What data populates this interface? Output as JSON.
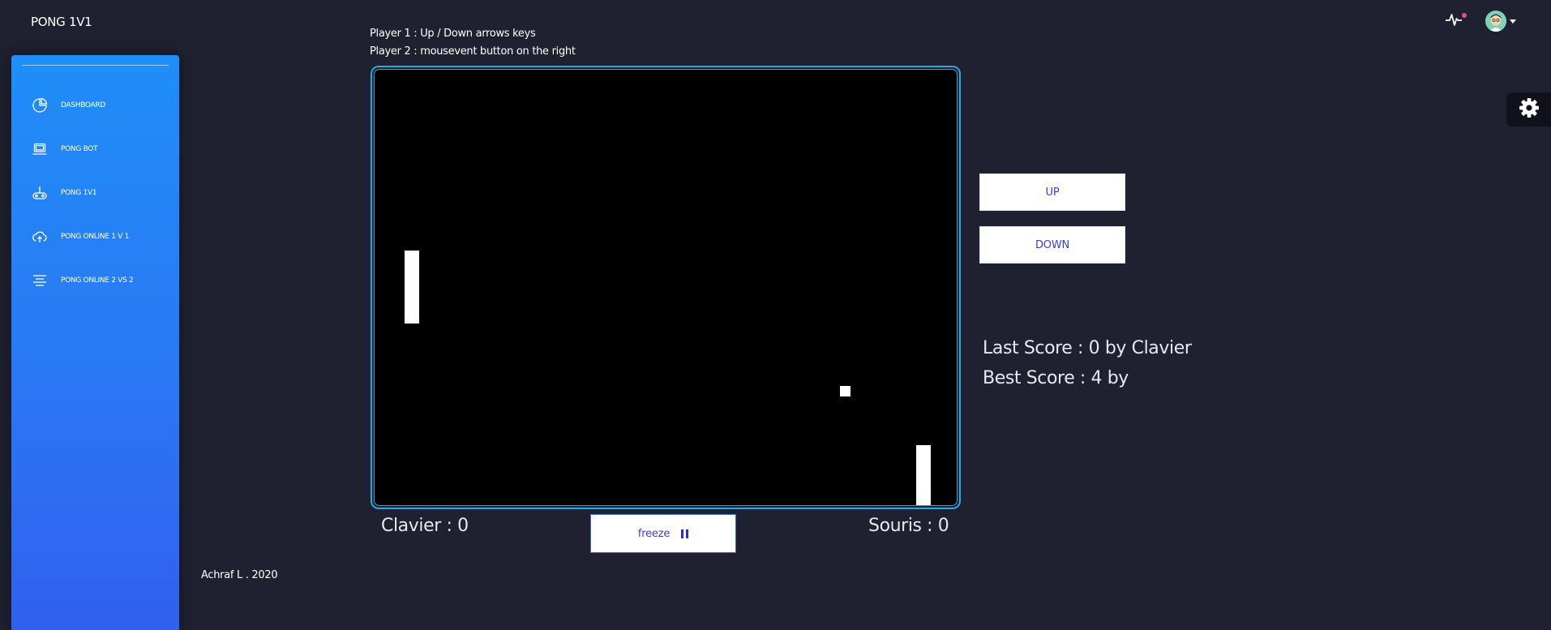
{
  "app": {
    "brand": "PONG 1V1"
  },
  "sidebar": {
    "items": [
      {
        "label": "DASHBOARD",
        "icon": "pie-chart-icon"
      },
      {
        "label": "PONG BOT",
        "icon": "laptop-icon"
      },
      {
        "label": "PONG 1V1",
        "icon": "gamepad-icon"
      },
      {
        "label": "PONG ONLINE 1 V 1",
        "icon": "cloud-upload-icon"
      },
      {
        "label": "PONG ONLINE 2 VS 2",
        "icon": "align-center-icon"
      }
    ]
  },
  "instructions": {
    "player1": "Player 1 : Up / Down arrows keys",
    "player2": "Player 2 : mousevent button on the right"
  },
  "game": {
    "left_score": "Clavier : 0",
    "right_score": "Souris : 0",
    "freeze_label": "freeze",
    "up_label": "UP",
    "down_label": "DOWN",
    "last_score": "Last Score : 0 by Clavier",
    "best_score": "Best Score : 4 by"
  },
  "footer": {
    "text": "Achraf L . 2020"
  },
  "header": {
    "activity_icon": "activity-pulse-icon",
    "avatar_icon": "user-avatar-icon",
    "settings_icon": "gear-icon"
  },
  "colors": {
    "background": "#1f2030",
    "sidebar_top": "#1f8ef8",
    "sidebar_bottom": "#3160ef",
    "board_border": "#29a7e1",
    "button_text": "#3b3bd9",
    "notification": "#ee4b8b"
  }
}
